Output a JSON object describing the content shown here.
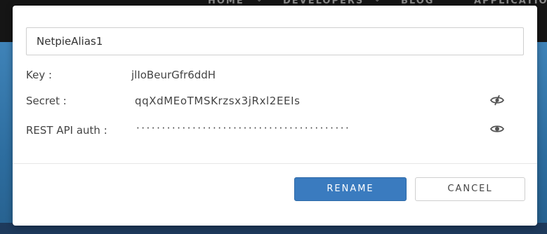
{
  "background_nav": {
    "items": [
      "HOME",
      "DEVELOPERS",
      "BLOG",
      "APPLICATIONS"
    ]
  },
  "dialog": {
    "alias_value": "NetpieAlias1",
    "key": {
      "label": "Key :",
      "value": "jlIoBeurGfr6ddH"
    },
    "secret": {
      "label": "Secret :",
      "value": "qqXdMEoTMSKrzsx3jRxl2EEIs",
      "icon": "eye-slash-icon"
    },
    "rest_api": {
      "label": "REST API auth :",
      "value": "··········································",
      "icon": "eye-icon"
    },
    "buttons": {
      "rename": "RENAME",
      "cancel": "CANCEL"
    }
  },
  "colors": {
    "primary_button": "#3a7bbf",
    "overlay_bg": "#2d6d9f"
  }
}
